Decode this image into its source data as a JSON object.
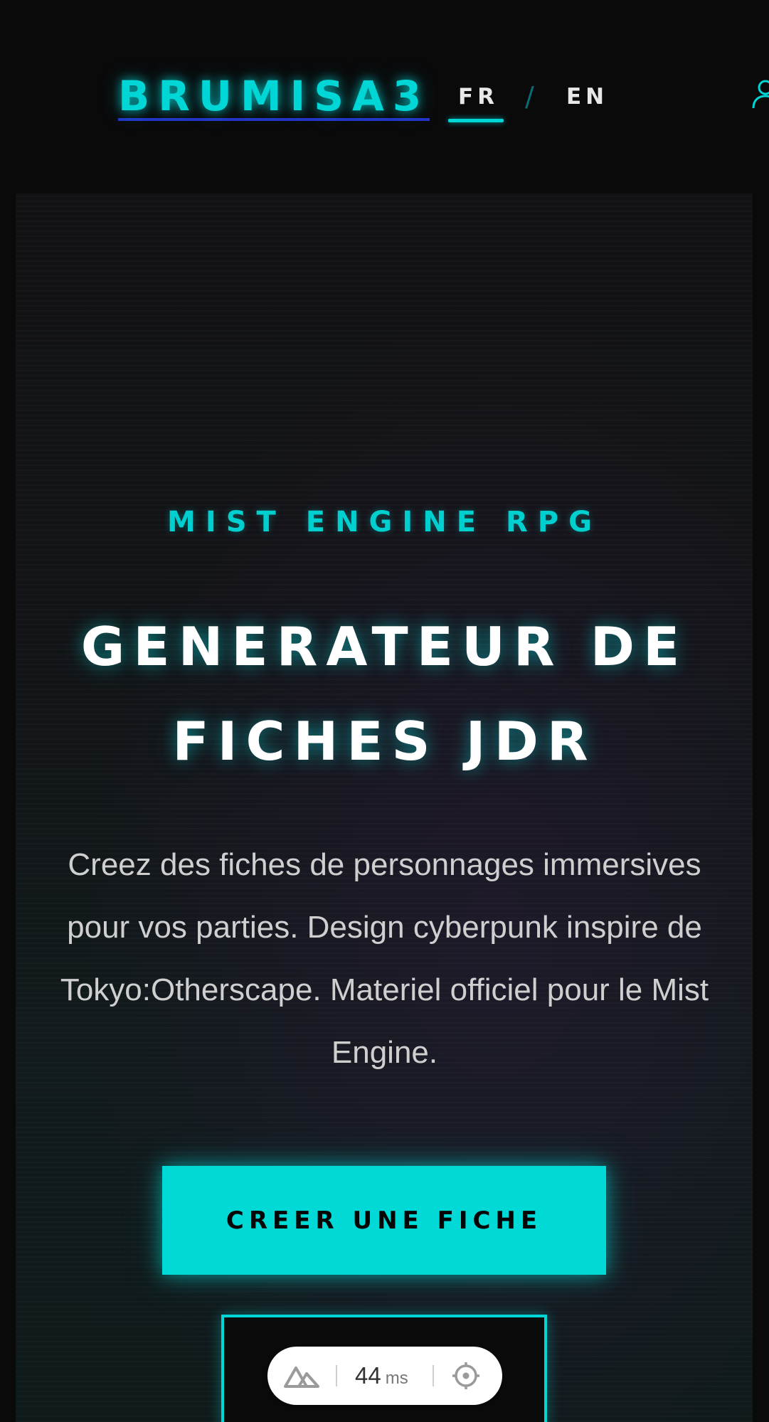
{
  "header": {
    "logo": "BRUMISA3",
    "lang_fr": "FR",
    "lang_sep": "/",
    "lang_en": "EN",
    "active_lang": "FR",
    "user_icon": "user-icon"
  },
  "hero": {
    "eyebrow": "MIST ENGINE RPG",
    "title_line1": "GENERATEUR DE",
    "title_line2": "FICHES JDR",
    "description": "Creez des fiches de personnages immersives pour vos parties. Design cyberpunk inspire de Tokyo:Otherscape. Materiel officiel pour le Mist Engine.",
    "cta_label": "CREER UNE FICHE"
  },
  "perf_pill": {
    "logo_icon": "nuxt-mountain-icon",
    "value": "44",
    "unit": "ms",
    "target_icon": "crosshair-icon"
  },
  "colors": {
    "accent": "#00d9d6",
    "background": "#0a0a0b",
    "link_underline": "#2433c9"
  }
}
